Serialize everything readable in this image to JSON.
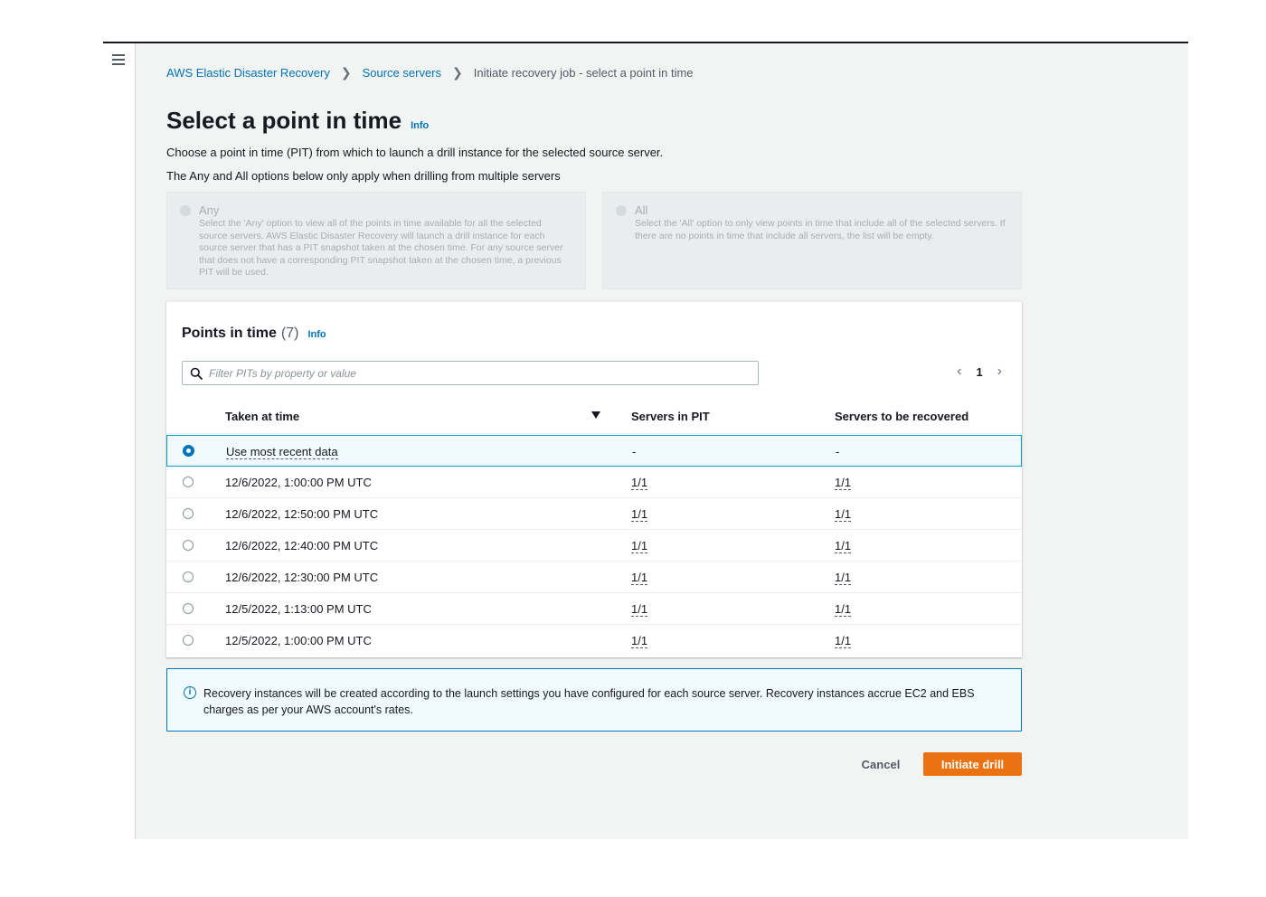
{
  "breadcrumb": {
    "items": [
      "AWS Elastic Disaster Recovery",
      "Source servers"
    ],
    "current": "Initiate recovery job - select a point in time"
  },
  "page": {
    "title": "Select a point in time",
    "info": "Info",
    "description": "Choose a point in time (PIT) from which to launch a drill instance for the selected source server.",
    "options_note": "The Any and All options below only apply when drilling from multiple servers"
  },
  "options": {
    "any": {
      "label": "Any",
      "text": "Select the 'Any' option to view all of the points in time available for all the selected source servers. AWS Elastic Disaster Recovery will launch a drill instance for each source server that has a PIT snapshot taken at the chosen time. For any source server that does not have a corresponding PIT snapshot taken at the chosen time, a previous PIT will be used."
    },
    "all": {
      "label": "All",
      "text": "Select the 'All' option to only view points in time that include all of the selected servers. If there are no points in time that include all servers, the list will be empty."
    }
  },
  "pits": {
    "title": "Points in time",
    "count": "(7)",
    "info": "Info",
    "filter_placeholder": "Filter PITs by property or value",
    "page": "1",
    "columns": {
      "taken": "Taken at time",
      "servers_in_pit": "Servers in PIT",
      "servers_recovered": "Servers to be recovered"
    },
    "rows": [
      {
        "time": "Use most recent data",
        "in_pit": "-",
        "recovered": "-"
      },
      {
        "time": "12/6/2022, 1:00:00 PM UTC",
        "in_pit": "1/1",
        "recovered": "1/1"
      },
      {
        "time": "12/6/2022, 12:50:00 PM UTC",
        "in_pit": "1/1",
        "recovered": "1/1"
      },
      {
        "time": "12/6/2022, 12:40:00 PM UTC",
        "in_pit": "1/1",
        "recovered": "1/1"
      },
      {
        "time": "12/6/2022, 12:30:00 PM UTC",
        "in_pit": "1/1",
        "recovered": "1/1"
      },
      {
        "time": "12/5/2022, 1:13:00 PM UTC",
        "in_pit": "1/1",
        "recovered": "1/1"
      },
      {
        "time": "12/5/2022, 1:00:00 PM UTC",
        "in_pit": "1/1",
        "recovered": "1/1"
      }
    ]
  },
  "alert": {
    "text": "Recovery instances will be created according to the launch settings you have configured for each source server. Recovery instances accrue EC2 and EBS charges as per your AWS account's rates."
  },
  "actions": {
    "cancel": "Cancel",
    "primary": "Initiate drill"
  },
  "colors": {
    "link": "#0073bb",
    "primary_button": "#ec7211",
    "selected_row_border": "#00a1c9"
  }
}
